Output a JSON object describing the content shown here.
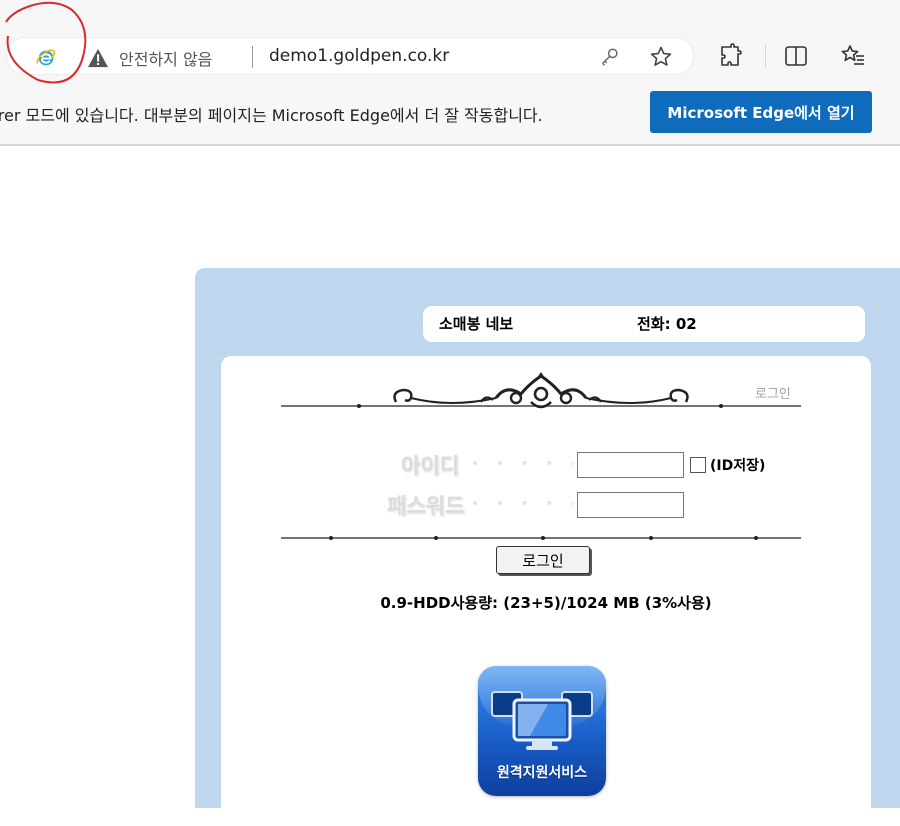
{
  "browser": {
    "address_bar": {
      "security_label": "안전하지 않음",
      "url": "demo1.goldpen.co.kr"
    },
    "icons": [
      "ie-icon",
      "warning-icon",
      "key-icon",
      "star-icon",
      "extensions-icon",
      "split-screen-icon",
      "favorites-icon"
    ]
  },
  "info_bar": {
    "message": "orer 모드에 있습니다. 대부분의 페이지는 Microsoft Edge에서 더 잘 작동합니다.",
    "button_label": "Microsoft Edge에서 열기"
  },
  "page": {
    "header": {
      "name": "소매봉 네보",
      "phone": "전화: 02"
    },
    "login": {
      "caption": "로그인",
      "id_label": "아이디",
      "pw_label": "패스워드",
      "dots": "• • • • ›",
      "id_value": "",
      "pw_value": "",
      "save_id_label": "(ID저장)",
      "save_id_checked": false,
      "button_label": "로그인"
    },
    "hdd_usage": "0.9-HDD사용량: (23+5)/1024 MB (3%사용)",
    "remote_support": {
      "label": "원격지원서비스"
    }
  },
  "colors": {
    "frame_bg": "#bed7ee",
    "edge_button": "#0f6cbd",
    "annotation_red": "#d92b2b"
  }
}
